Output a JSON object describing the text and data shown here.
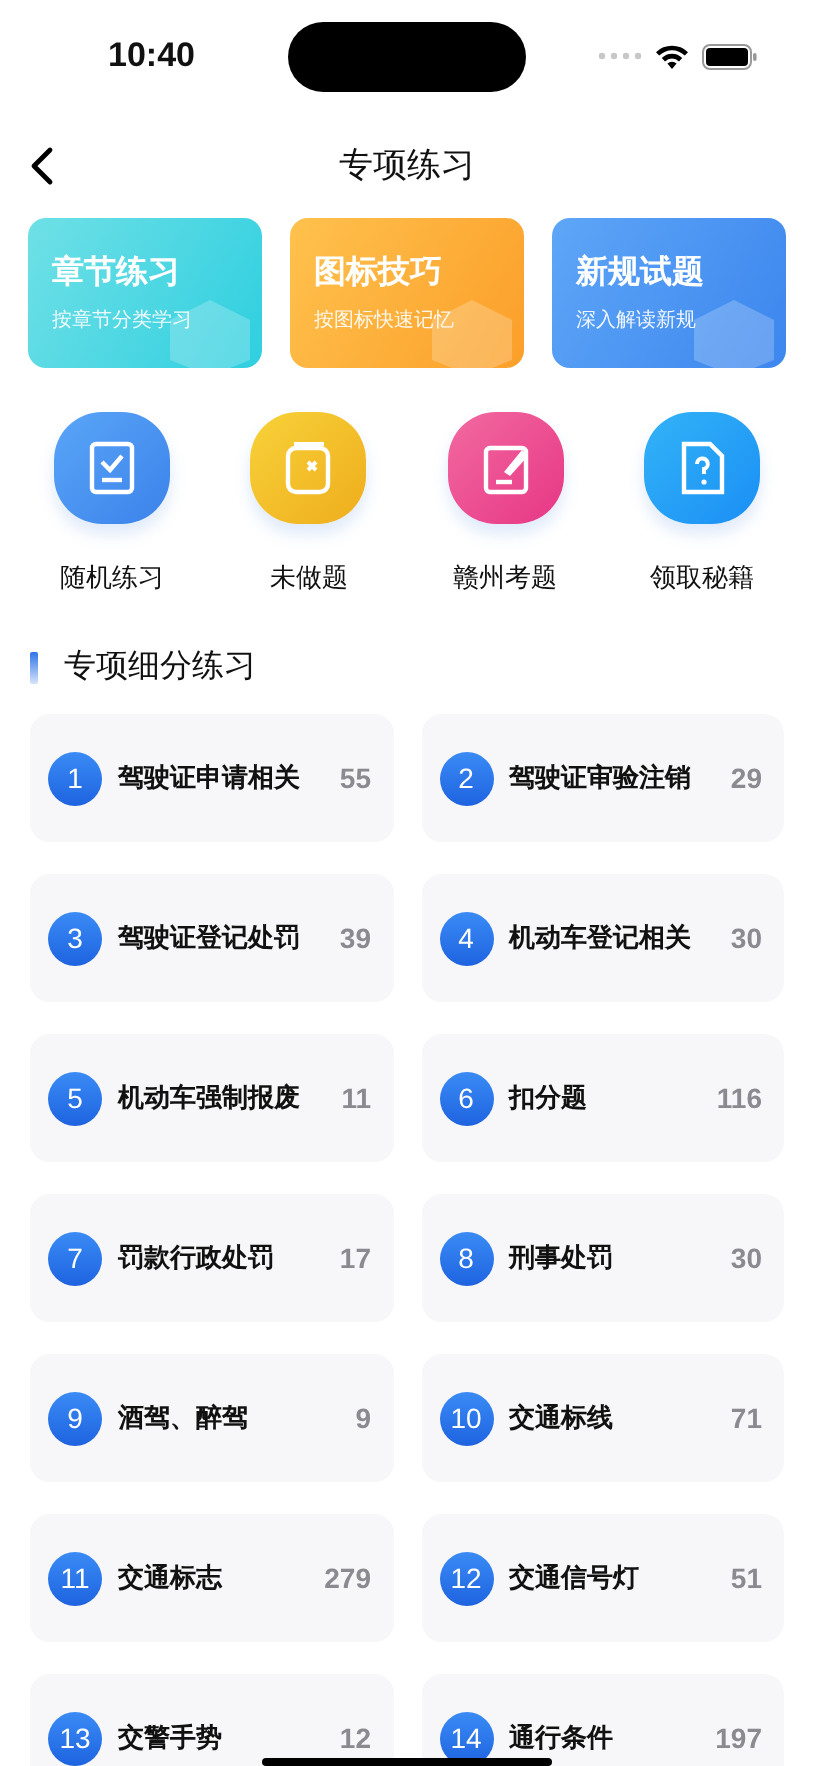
{
  "status_bar": {
    "time": "10:40"
  },
  "nav": {
    "title": "专项练习"
  },
  "banners": [
    {
      "kind": "chapter",
      "title": "章节练习",
      "subtitle": "按章节分类学习"
    },
    {
      "kind": "sign",
      "title": "图标技巧",
      "subtitle": "按图标快速记忆"
    },
    {
      "kind": "rules",
      "title": "新规试题",
      "subtitle": "深入解读新规"
    }
  ],
  "shortcuts": [
    {
      "kind": "random",
      "label": "随机练习"
    },
    {
      "kind": "undone",
      "label": "未做题"
    },
    {
      "kind": "local",
      "label": "赣州考题"
    },
    {
      "kind": "secret",
      "label": "领取秘籍"
    }
  ],
  "section": {
    "title": "专项细分练习"
  },
  "topics": [
    {
      "index": "1",
      "name": "驾驶证申请相关",
      "count": "55"
    },
    {
      "index": "2",
      "name": "驾驶证审验注销",
      "count": "29"
    },
    {
      "index": "3",
      "name": "驾驶证登记处罚",
      "count": "39"
    },
    {
      "index": "4",
      "name": "机动车登记相关",
      "count": "30"
    },
    {
      "index": "5",
      "name": "机动车强制报废",
      "count": "11"
    },
    {
      "index": "6",
      "name": "扣分题",
      "count": "116"
    },
    {
      "index": "7",
      "name": "罚款行政处罚",
      "count": "17"
    },
    {
      "index": "8",
      "name": "刑事处罚",
      "count": "30"
    },
    {
      "index": "9",
      "name": "酒驾、醉驾",
      "count": "9"
    },
    {
      "index": "10",
      "name": "交通标线",
      "count": "71"
    },
    {
      "index": "11",
      "name": "交通标志",
      "count": "279"
    },
    {
      "index": "12",
      "name": "交通信号灯",
      "count": "51"
    },
    {
      "index": "13",
      "name": "交警手势",
      "count": "12"
    },
    {
      "index": "14",
      "name": "通行条件",
      "count": "197"
    }
  ]
}
